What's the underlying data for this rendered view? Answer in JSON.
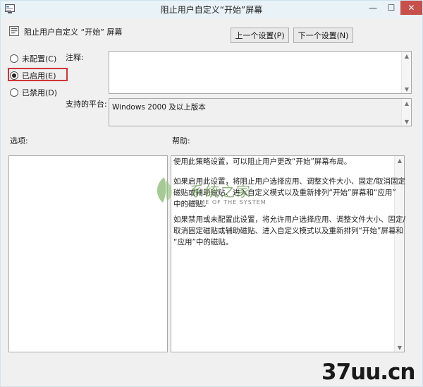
{
  "window": {
    "title": "阻止用户自定义“开始”屏幕",
    "min_glyph": "—",
    "max_glyph": "☐",
    "close_glyph": "✕"
  },
  "policy": {
    "name": "阻止用户自定义 “开始” 屏幕",
    "prev_button": "上一个设置(P)",
    "next_button": "下一个设置(N)"
  },
  "state_options": [
    {
      "label": "未配置(C)",
      "checked": false
    },
    {
      "label": "已启用(E)",
      "checked": true
    },
    {
      "label": "已禁用(D)",
      "checked": false
    }
  ],
  "comment": {
    "label": "注释:",
    "value": ""
  },
  "supported": {
    "label": "支持的平台:",
    "value": "Windows 2000 及以上版本"
  },
  "options": {
    "label": "选项:"
  },
  "help": {
    "label": "帮助:",
    "lines": [
      "使用此策略设置，可以阻止用户更改“开始”屏幕布局。",
      "",
      "如果启用此设置，将阻止用户选择应用、调整文件大小、固定/取消固定",
      "磁贴或辅助磁贴、进入自定义模式以及重新排列“开始”屏幕和“应用”",
      "中的磁贴。",
      "",
      "如果禁用或未配置此设置，将允许用户选择应用、调整文件大小、固定/",
      "取消固定磁贴或辅助磁贴、进入自定义模式以及重新排列“开始”屏幕和",
      "“应用”中的磁贴。"
    ]
  },
  "watermark": {
    "title": "系统之家",
    "subtitle": "HOME OF THE SYSTEM",
    "site": "37uu.cn"
  },
  "icons": {
    "app": "policy-editor-icon",
    "policy": "policy-setting-icon",
    "scroll_up": "scroll-up-arrow-icon",
    "scroll_down": "scroll-down-arrow-icon",
    "watermark": "leaf-logo-icon"
  },
  "colors": {
    "highlight_box": "#d1343a",
    "close_button": "#c7504a",
    "titlebar": "#e8f2f7"
  }
}
